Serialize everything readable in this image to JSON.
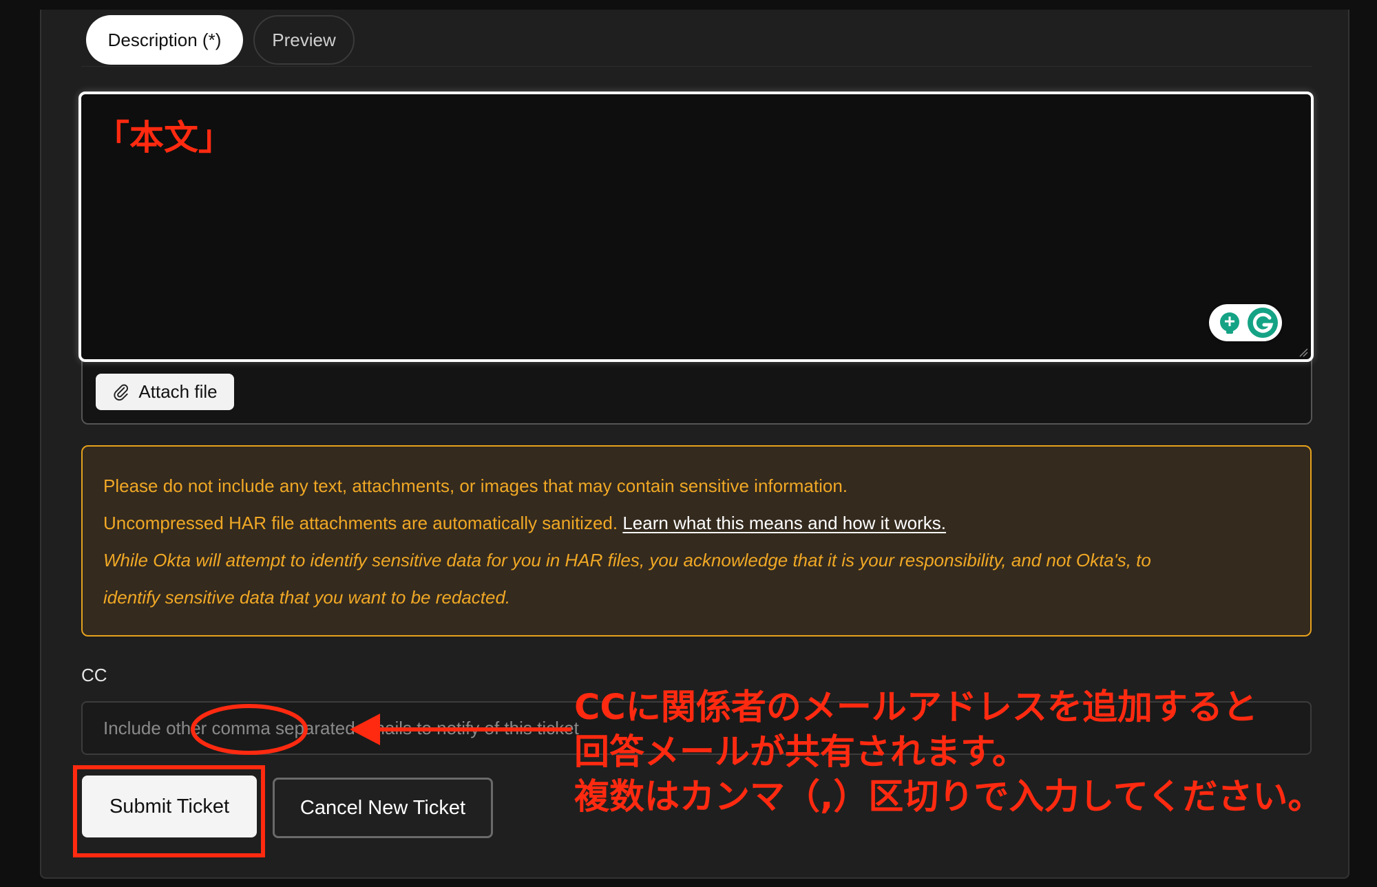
{
  "tabs": {
    "description_label": "Description (*)",
    "preview_label": "Preview"
  },
  "editor": {
    "body_annotation": "「本文」",
    "attach_label": "Attach file"
  },
  "warning": {
    "line1": "Please do not include any text, attachments, or images that may contain sensitive information.",
    "line2": "Uncompressed HAR file attachments are automatically sanitized.",
    "line2_link": "Learn what this means and how it works.",
    "line3": "While Okta will attempt to identify sensitive data for you in HAR files, you acknowledge that it is your responsibility, and not Okta's, to",
    "line4": "identify sensitive data that you want to be redacted."
  },
  "cc": {
    "label": "CC",
    "placeholder": "Include other comma separated emails to notify of this ticket"
  },
  "actions": {
    "submit_label": "Submit Ticket",
    "cancel_label": "Cancel New Ticket"
  },
  "annotation": {
    "cc_note_line1": "CCに関係者のメールアドレスを追加すると",
    "cc_note_line2": "回答メールが共有されます。",
    "cc_note_line3": "複数はカンマ（,）区切りで入力してください。"
  },
  "colors": {
    "annotation_red": "#ff2a10",
    "warning_text": "#f0a825",
    "warning_border": "#e6a21c",
    "grammarly_green": "#15a385"
  },
  "icons": {
    "attach": "paperclip-icon",
    "grammarly_bulb": "lightbulb-icon",
    "grammarly_logo": "grammarly-icon"
  }
}
